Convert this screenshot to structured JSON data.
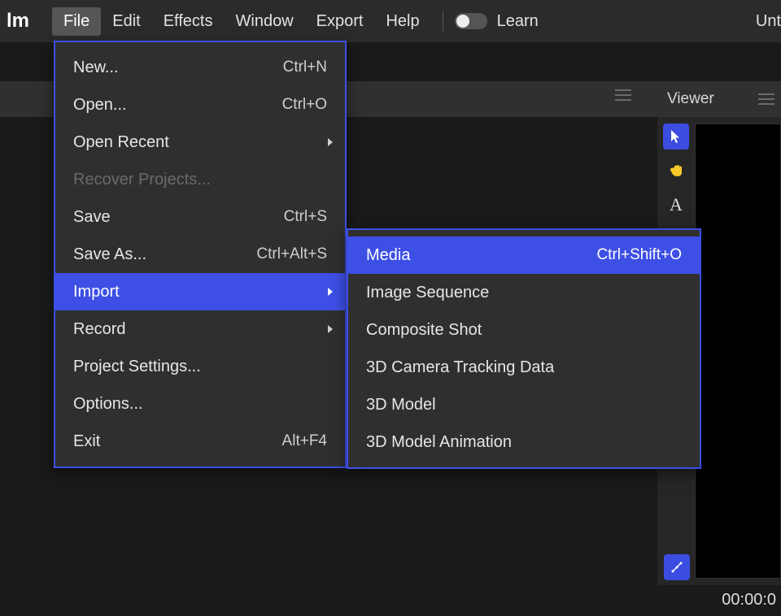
{
  "app": {
    "logo": "lm",
    "doc_title": "Unt"
  },
  "menubar": {
    "file": "File",
    "edit": "Edit",
    "effects": "Effects",
    "window": "Window",
    "export": "Export",
    "help": "Help",
    "learn": "Learn"
  },
  "file_menu": {
    "new": {
      "label": "New...",
      "shortcut": "Ctrl+N"
    },
    "open": {
      "label": "Open...",
      "shortcut": "Ctrl+O"
    },
    "open_recent": {
      "label": "Open Recent"
    },
    "recover": {
      "label": "Recover Projects..."
    },
    "save": {
      "label": "Save",
      "shortcut": "Ctrl+S"
    },
    "save_as": {
      "label": "Save As...",
      "shortcut": "Ctrl+Alt+S"
    },
    "import": {
      "label": "Import"
    },
    "record": {
      "label": "Record"
    },
    "project_settings": {
      "label": "Project Settings..."
    },
    "options": {
      "label": "Options..."
    },
    "exit": {
      "label": "Exit",
      "shortcut": "Alt+F4"
    }
  },
  "import_submenu": {
    "media": {
      "label": "Media",
      "shortcut": "Ctrl+Shift+O"
    },
    "image_sequence": {
      "label": "Image Sequence"
    },
    "composite_shot": {
      "label": "Composite Shot"
    },
    "camera_tracking": {
      "label": "3D Camera Tracking Data"
    },
    "model": {
      "label": "3D Model"
    },
    "model_anim": {
      "label": "3D Model Animation"
    }
  },
  "panels": {
    "viewer": "Viewer"
  },
  "timeline": {
    "timecode": "00:00:0"
  }
}
